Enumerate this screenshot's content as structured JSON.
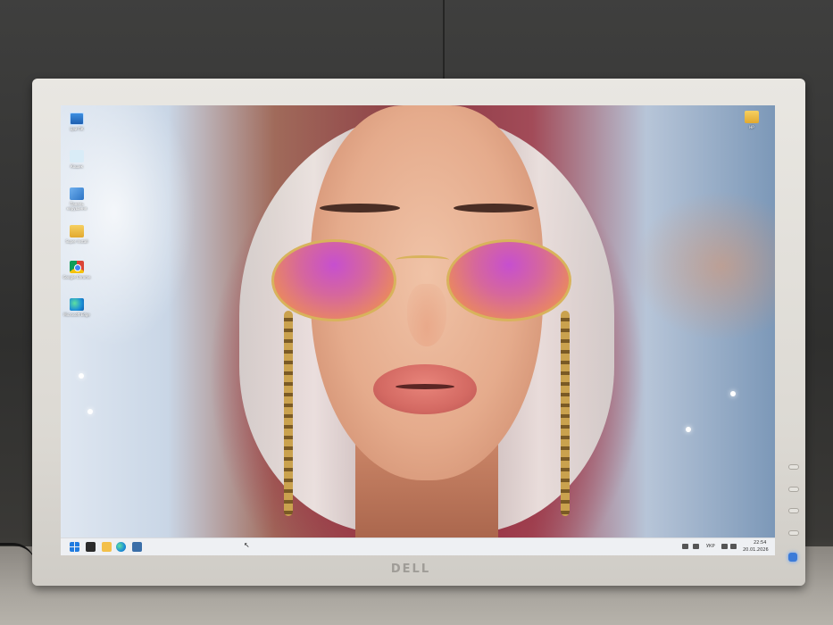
{
  "monitor": {
    "brand_logo": "DELL"
  },
  "desktop": {
    "icons_left": [
      {
        "icon": "computer-icon",
        "label": "Цей ПК"
      },
      {
        "icon": "recycle-bin-icon",
        "label": "Кошик"
      },
      {
        "icon": "control-panel-icon",
        "label": "Панель керування"
      },
      {
        "icon": "folder-icon",
        "label": "Super Install"
      },
      {
        "icon": "chrome-icon",
        "label": "Google Chrome"
      },
      {
        "icon": "edge-icon",
        "label": "Microsoft Edge"
      }
    ],
    "icons_right": [
      {
        "icon": "folder-icon",
        "label": "HP"
      }
    ]
  },
  "taskbar": {
    "pinned": [
      "start-icon",
      "task-view-icon",
      "file-explorer-icon",
      "edge-icon",
      "app-icon"
    ],
    "tray": {
      "language": "УКР",
      "time": "22:54",
      "date": "20.01.2026"
    }
  },
  "colors": {
    "bezel": "#e5e3de",
    "taskbar": "#eef0f3",
    "accent": "#1f7be0"
  }
}
